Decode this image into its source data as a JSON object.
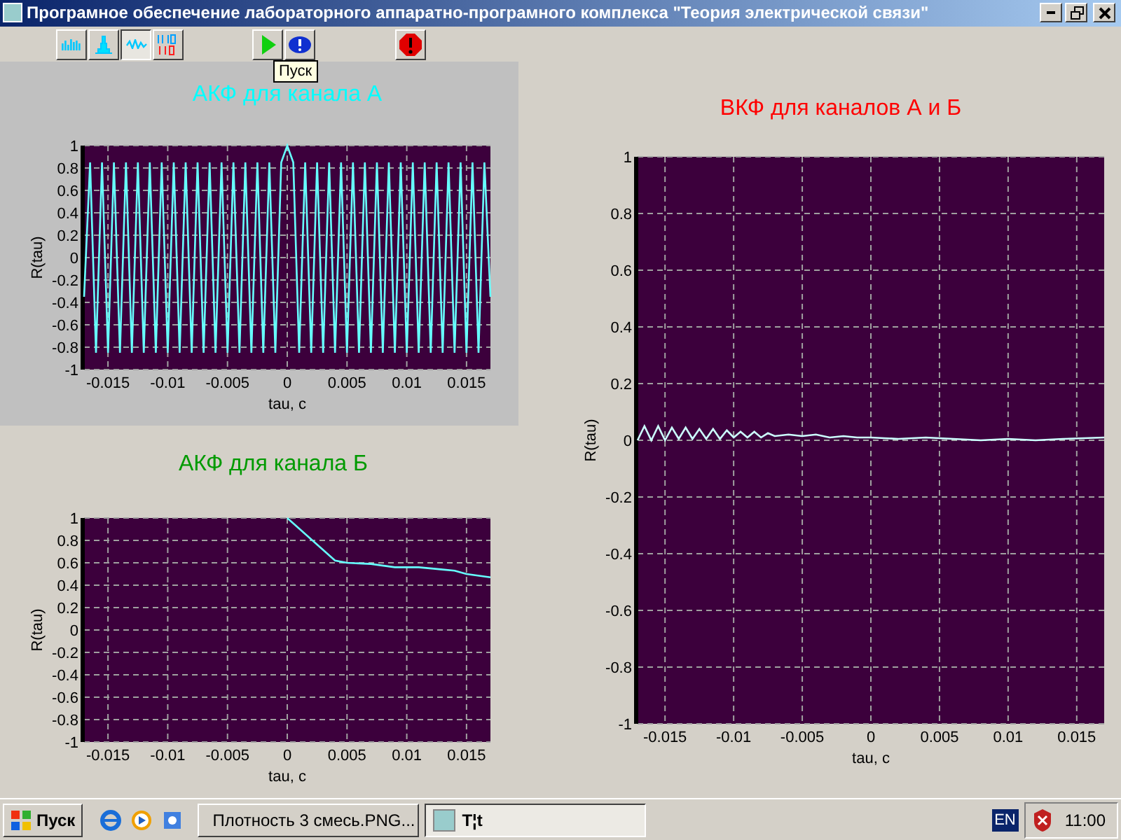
{
  "window": {
    "title": "Програмное обеспечение лабораторного аппаратно-програмного комплекса \"Теория электрической связи\""
  },
  "toolbar": {
    "buttons": [
      {
        "pressed": false
      },
      {
        "pressed": false
      },
      {
        "pressed": true
      },
      {
        "pressed": false
      },
      {
        "pressed": false
      },
      {
        "pressed": false
      },
      {
        "pressed": false
      }
    ],
    "tooltip": "Пуск"
  },
  "charts": [
    {
      "chart_data": {
        "type": "line",
        "title": "АКФ для канала А",
        "xlabel": "tau, c",
        "ylabel": "R(tau)",
        "xlim": [
          -0.017,
          0.017
        ],
        "ylim": [
          -1,
          1
        ],
        "xticks": [
          -0.015,
          -0.01,
          -0.005,
          0,
          0.005,
          0.01,
          0.015
        ],
        "yticks": [
          -1,
          -0.8,
          -0.6,
          -0.4,
          -0.2,
          0,
          0.2,
          0.4,
          0.6,
          0.8,
          1
        ],
        "x": [
          -0.017,
          -0.0165,
          -0.016,
          -0.0155,
          -0.015,
          -0.0145,
          -0.014,
          -0.0135,
          -0.013,
          -0.0125,
          -0.012,
          -0.0115,
          -0.011,
          -0.0105,
          -0.01,
          -0.0095,
          -0.009,
          -0.0085,
          -0.008,
          -0.0075,
          -0.007,
          -0.0065,
          -0.006,
          -0.0055,
          -0.005,
          -0.0045,
          -0.004,
          -0.0035,
          -0.003,
          -0.0025,
          -0.002,
          -0.0015,
          -0.001,
          -0.0005,
          0,
          0.0005,
          0.001,
          0.0015,
          0.002,
          0.0025,
          0.003,
          0.0035,
          0.004,
          0.0045,
          0.005,
          0.0055,
          0.006,
          0.0065,
          0.007,
          0.0075,
          0.008,
          0.0085,
          0.009,
          0.0095,
          0.01,
          0.0105,
          0.011,
          0.0115,
          0.012,
          0.0125,
          0.013,
          0.0135,
          0.014,
          0.0145,
          0.015,
          0.0155,
          0.016,
          0.0165,
          0.017
        ],
        "grid": true,
        "series": [
          {
            "color": "#66ffff",
            "values": [
              -0.35,
              0.85,
              -0.85,
              0.85,
              -0.85,
              0.85,
              -0.85,
              0.85,
              -0.85,
              0.85,
              -0.85,
              0.85,
              -0.85,
              0.85,
              -0.85,
              0.85,
              -0.85,
              0.85,
              -0.85,
              0.85,
              -0.85,
              0.85,
              -0.85,
              0.85,
              -0.85,
              0.85,
              -0.85,
              0.85,
              -0.85,
              0.85,
              -0.85,
              0.85,
              -0.85,
              0.85,
              1,
              0.85,
              -0.85,
              0.85,
              -0.85,
              0.85,
              -0.85,
              0.85,
              -0.85,
              0.85,
              -0.85,
              0.85,
              -0.85,
              0.85,
              -0.85,
              0.85,
              -0.85,
              0.85,
              -0.85,
              0.85,
              -0.85,
              0.85,
              -0.85,
              0.85,
              -0.85,
              0.85,
              -0.85,
              0.85,
              -0.85,
              0.85,
              -0.85,
              0.85,
              -0.85,
              0.85,
              -0.35
            ]
          }
        ]
      }
    },
    {
      "chart_data": {
        "type": "line",
        "title": "АКФ для канала Б",
        "xlabel": "tau, c",
        "ylabel": "R(tau)",
        "xlim": [
          -0.017,
          0.017
        ],
        "ylim": [
          -1,
          1
        ],
        "xticks": [
          -0.015,
          -0.01,
          -0.005,
          0,
          0.005,
          0.01,
          0.015
        ],
        "yticks": [
          -1,
          -0.8,
          -0.6,
          -0.4,
          -0.2,
          0,
          0.2,
          0.4,
          0.6,
          0.8,
          1
        ],
        "x": [
          0,
          0.004,
          0.005,
          0.007,
          0.009,
          0.011,
          0.013,
          0.014,
          0.015,
          0.017
        ],
        "grid": true,
        "series": [
          {
            "color": "#66ffff",
            "values": [
              1,
              0.62,
              0.6,
              0.59,
              0.56,
              0.56,
              0.54,
              0.53,
              0.5,
              0.47
            ]
          }
        ]
      }
    },
    {
      "chart_data": {
        "type": "line",
        "title": "ВКФ для каналов А и Б",
        "xlabel": "tau, c",
        "ylabel": "R(tau)",
        "xlim": [
          -0.017,
          0.017
        ],
        "ylim": [
          -1,
          1
        ],
        "xticks": [
          -0.015,
          -0.01,
          -0.005,
          0,
          0.005,
          0.01,
          0.015
        ],
        "yticks": [
          -1,
          -0.8,
          -0.6,
          -0.4,
          -0.2,
          0,
          0.2,
          0.4,
          0.6,
          0.8,
          1
        ],
        "x": [
          -0.017,
          -0.0165,
          -0.016,
          -0.0155,
          -0.015,
          -0.0145,
          -0.014,
          -0.0135,
          -0.013,
          -0.0125,
          -0.012,
          -0.0115,
          -0.011,
          -0.0105,
          -0.01,
          -0.0095,
          -0.009,
          -0.0085,
          -0.008,
          -0.0075,
          -0.007,
          -0.006,
          -0.005,
          -0.004,
          -0.003,
          -0.002,
          -0.001,
          0,
          0.002,
          0.004,
          0.006,
          0.008,
          0.01,
          0.012,
          0.014,
          0.017
        ],
        "grid": true,
        "series": [
          {
            "color": "#ccffff",
            "values": [
              0.0,
              0.05,
              0.0,
              0.05,
              0.0,
              0.045,
              0.005,
              0.045,
              0.005,
              0.04,
              0.005,
              0.04,
              0.005,
              0.035,
              0.01,
              0.03,
              0.01,
              0.03,
              0.01,
              0.025,
              0.015,
              0.02,
              0.015,
              0.02,
              0.01,
              0.015,
              0.01,
              0.01,
              0.005,
              0.01,
              0.005,
              0.0,
              0.005,
              0.0,
              0.005,
              0.01
            ]
          }
        ]
      }
    }
  ],
  "taskbar": {
    "start": "Пуск",
    "tasks": [
      {
        "label": "Плотность 3 смесь.PNG...",
        "selected": false
      },
      {
        "label": "T¦t",
        "selected": true
      }
    ],
    "language": "EN",
    "clock": "11:00"
  }
}
